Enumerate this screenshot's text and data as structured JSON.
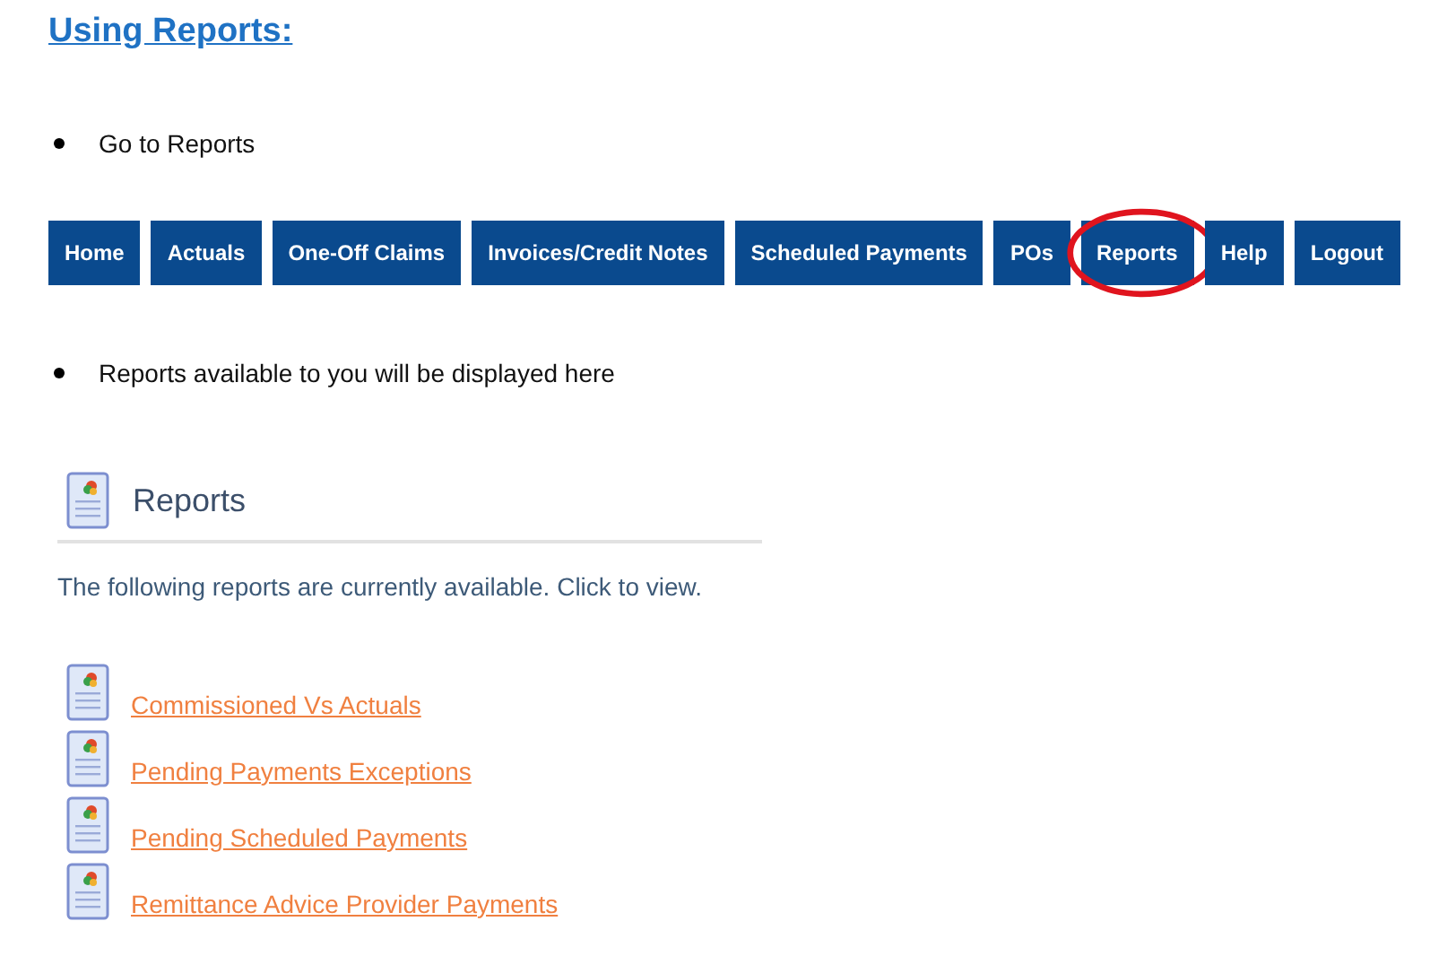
{
  "heading": "Using Reports:",
  "bullets": [
    "Go to Reports",
    "Reports available to you will be displayed here"
  ],
  "nav": [
    {
      "label": "Home",
      "circled": false
    },
    {
      "label": "Actuals",
      "circled": false
    },
    {
      "label": "One-Off Claims",
      "circled": false
    },
    {
      "label": "Invoices/Credit Notes",
      "circled": false
    },
    {
      "label": "Scheduled Payments",
      "circled": false
    },
    {
      "label": "POs",
      "circled": false
    },
    {
      "label": "Reports",
      "circled": true
    },
    {
      "label": "Help",
      "circled": false
    },
    {
      "label": "Logout",
      "circled": false
    }
  ],
  "panel": {
    "title": "Reports",
    "intro": "The following reports are currently available. Click to view.",
    "reports": [
      "Commissioned Vs Actuals",
      "Pending Payments Exceptions",
      "Pending Scheduled Payments",
      "Remittance Advice Provider Payments"
    ]
  }
}
